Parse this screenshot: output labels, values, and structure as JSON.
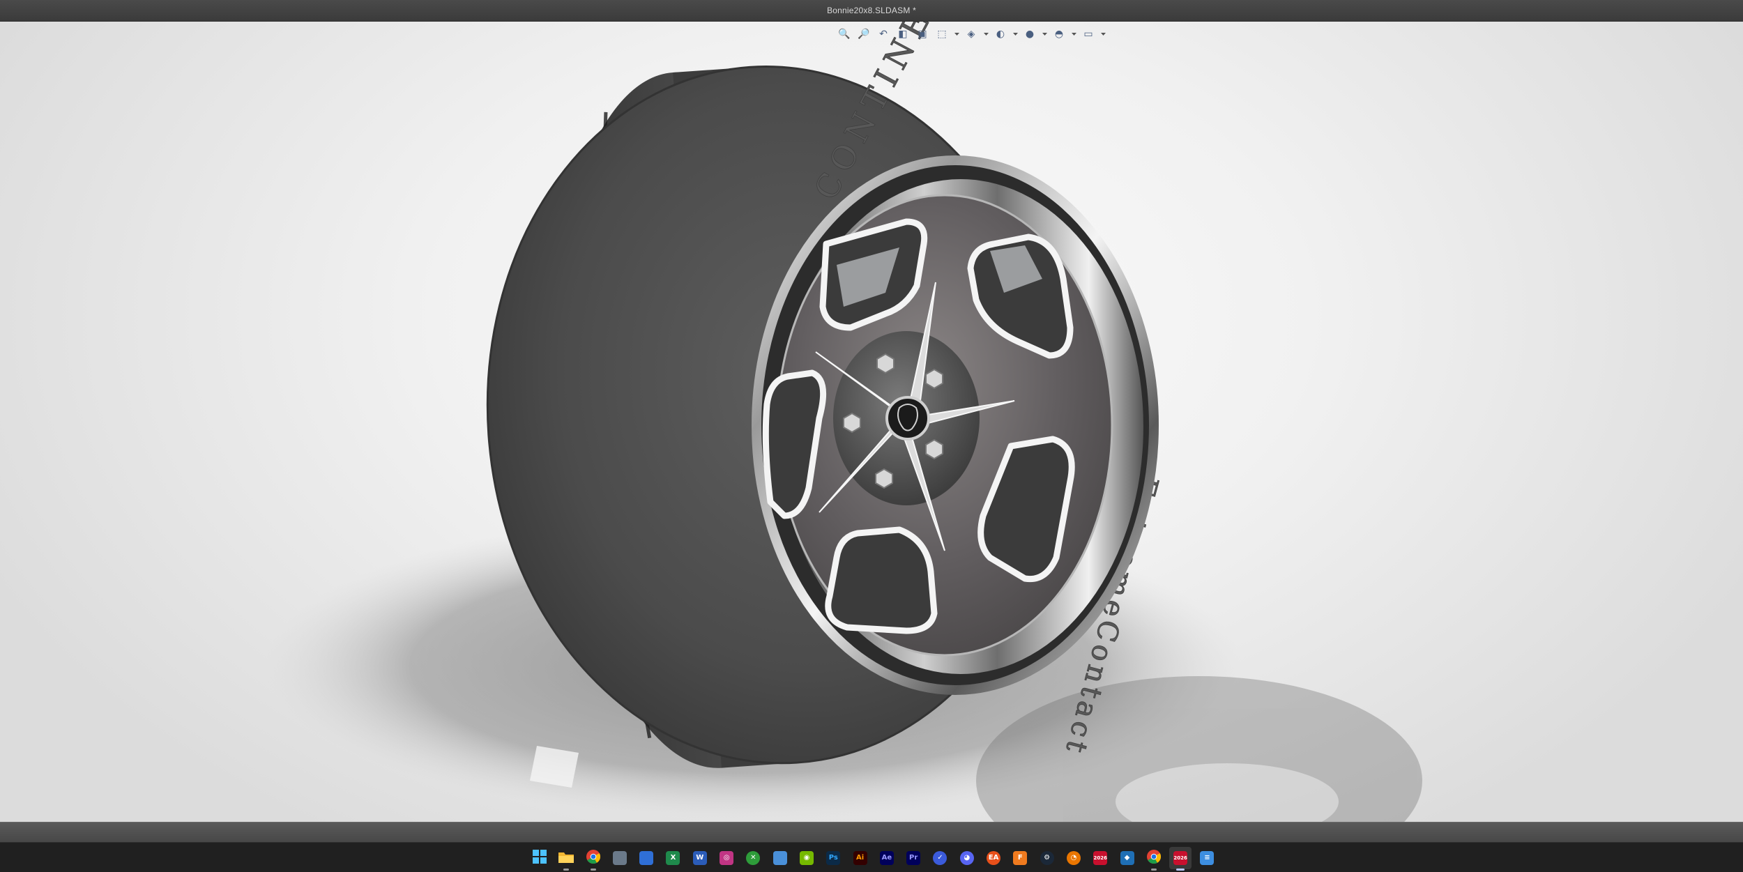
{
  "window": {
    "title": "Bonnie20x8.SLDASM *"
  },
  "viewport": {
    "heads_up_toolbar": [
      {
        "name": "zoom-to-fit-icon",
        "glyph": "🔍",
        "has_menu": false
      },
      {
        "name": "zoom-to-area-icon",
        "glyph": "🔎",
        "has_menu": false
      },
      {
        "name": "previous-view-icon",
        "glyph": "↶",
        "has_menu": false
      },
      {
        "name": "section-view-icon",
        "glyph": "◧",
        "has_menu": false
      },
      {
        "name": "dynamic-annotation-icon",
        "glyph": "▣",
        "has_menu": false
      },
      {
        "name": "view-orientation-icon",
        "glyph": "⬚",
        "has_menu": true
      },
      {
        "name": "display-style-icon",
        "glyph": "◈",
        "has_menu": true
      },
      {
        "name": "hide-show-items-icon",
        "glyph": "◐",
        "has_menu": true
      },
      {
        "name": "edit-appearance-icon",
        "glyph": "●",
        "has_menu": true
      },
      {
        "name": "apply-scene-icon",
        "glyph": "◓",
        "has_menu": true
      },
      {
        "name": "view-settings-icon",
        "glyph": "▭",
        "has_menu": true
      }
    ],
    "tire_sidewall_text": [
      "CONTINENTAL",
      "ExtremeContact"
    ]
  },
  "taskbar": {
    "apps": [
      {
        "name": "start-button",
        "label": "",
        "color": "#3aa0ff",
        "kind": "windows"
      },
      {
        "name": "file-explorer-icon",
        "label": "",
        "color": "#f2b632",
        "kind": "folder",
        "running": true
      },
      {
        "name": "chrome-icon",
        "label": "",
        "color": "#e34133",
        "kind": "chrome",
        "running": true
      },
      {
        "name": "calculator-icon",
        "label": "",
        "color": "#6b7a8a",
        "kind": "box"
      },
      {
        "name": "store-icon",
        "label": "",
        "color": "#2f6fd6",
        "kind": "box"
      },
      {
        "name": "excel-icon",
        "label": "X",
        "color": "#1f8a4c",
        "kind": "box"
      },
      {
        "name": "word-icon",
        "label": "W",
        "color": "#2b5cb8",
        "kind": "box"
      },
      {
        "name": "instagram-icon",
        "label": "◎",
        "color": "#c13584",
        "kind": "box"
      },
      {
        "name": "xbox-icon",
        "label": "✕",
        "color": "#2e9c3a",
        "kind": "round"
      },
      {
        "name": "notepad-icon",
        "label": "",
        "color": "#4a90d9",
        "kind": "box"
      },
      {
        "name": "nvidia-icon",
        "label": "◉",
        "color": "#76b900",
        "kind": "box"
      },
      {
        "name": "photoshop-icon",
        "label": "Ps",
        "color": "#0b2a47",
        "kind": "box",
        "text_color": "#31a8ff"
      },
      {
        "name": "illustrator-icon",
        "label": "Ai",
        "color": "#330000",
        "kind": "box",
        "text_color": "#ff9a00"
      },
      {
        "name": "after-effects-icon",
        "label": "Ae",
        "color": "#00005b",
        "kind": "box",
        "text_color": "#9999ff"
      },
      {
        "name": "premiere-icon",
        "label": "Pr",
        "color": "#00005b",
        "kind": "box",
        "text_color": "#9999ff"
      },
      {
        "name": "mail-icon",
        "label": "✓",
        "color": "#3b5bdb",
        "kind": "round"
      },
      {
        "name": "discord-icon",
        "label": "◕",
        "color": "#5865f2",
        "kind": "round"
      },
      {
        "name": "ea-icon",
        "label": "EA",
        "color": "#e8501a",
        "kind": "round"
      },
      {
        "name": "fusion-icon",
        "label": "F",
        "color": "#f07b1f",
        "kind": "box"
      },
      {
        "name": "steam-icon",
        "label": "⚙",
        "color": "#1b2838",
        "kind": "round"
      },
      {
        "name": "blender-icon",
        "label": "◔",
        "color": "#ea7600",
        "kind": "round"
      },
      {
        "name": "solidworks-2026-icon",
        "label": "2026",
        "color": "#c8102e",
        "kind": "box"
      },
      {
        "name": "sketchup-icon",
        "label": "◆",
        "color": "#1f6fb5",
        "kind": "box"
      },
      {
        "name": "chrome-alt-icon",
        "label": "",
        "color": "#e34133",
        "kind": "chrome",
        "running": true
      },
      {
        "name": "solidworks-2026-active-icon",
        "label": "2026",
        "color": "#c8102e",
        "kind": "box",
        "active": true
      },
      {
        "name": "text-editor-icon",
        "label": "≡",
        "color": "#3d8ee0",
        "kind": "box"
      }
    ]
  }
}
